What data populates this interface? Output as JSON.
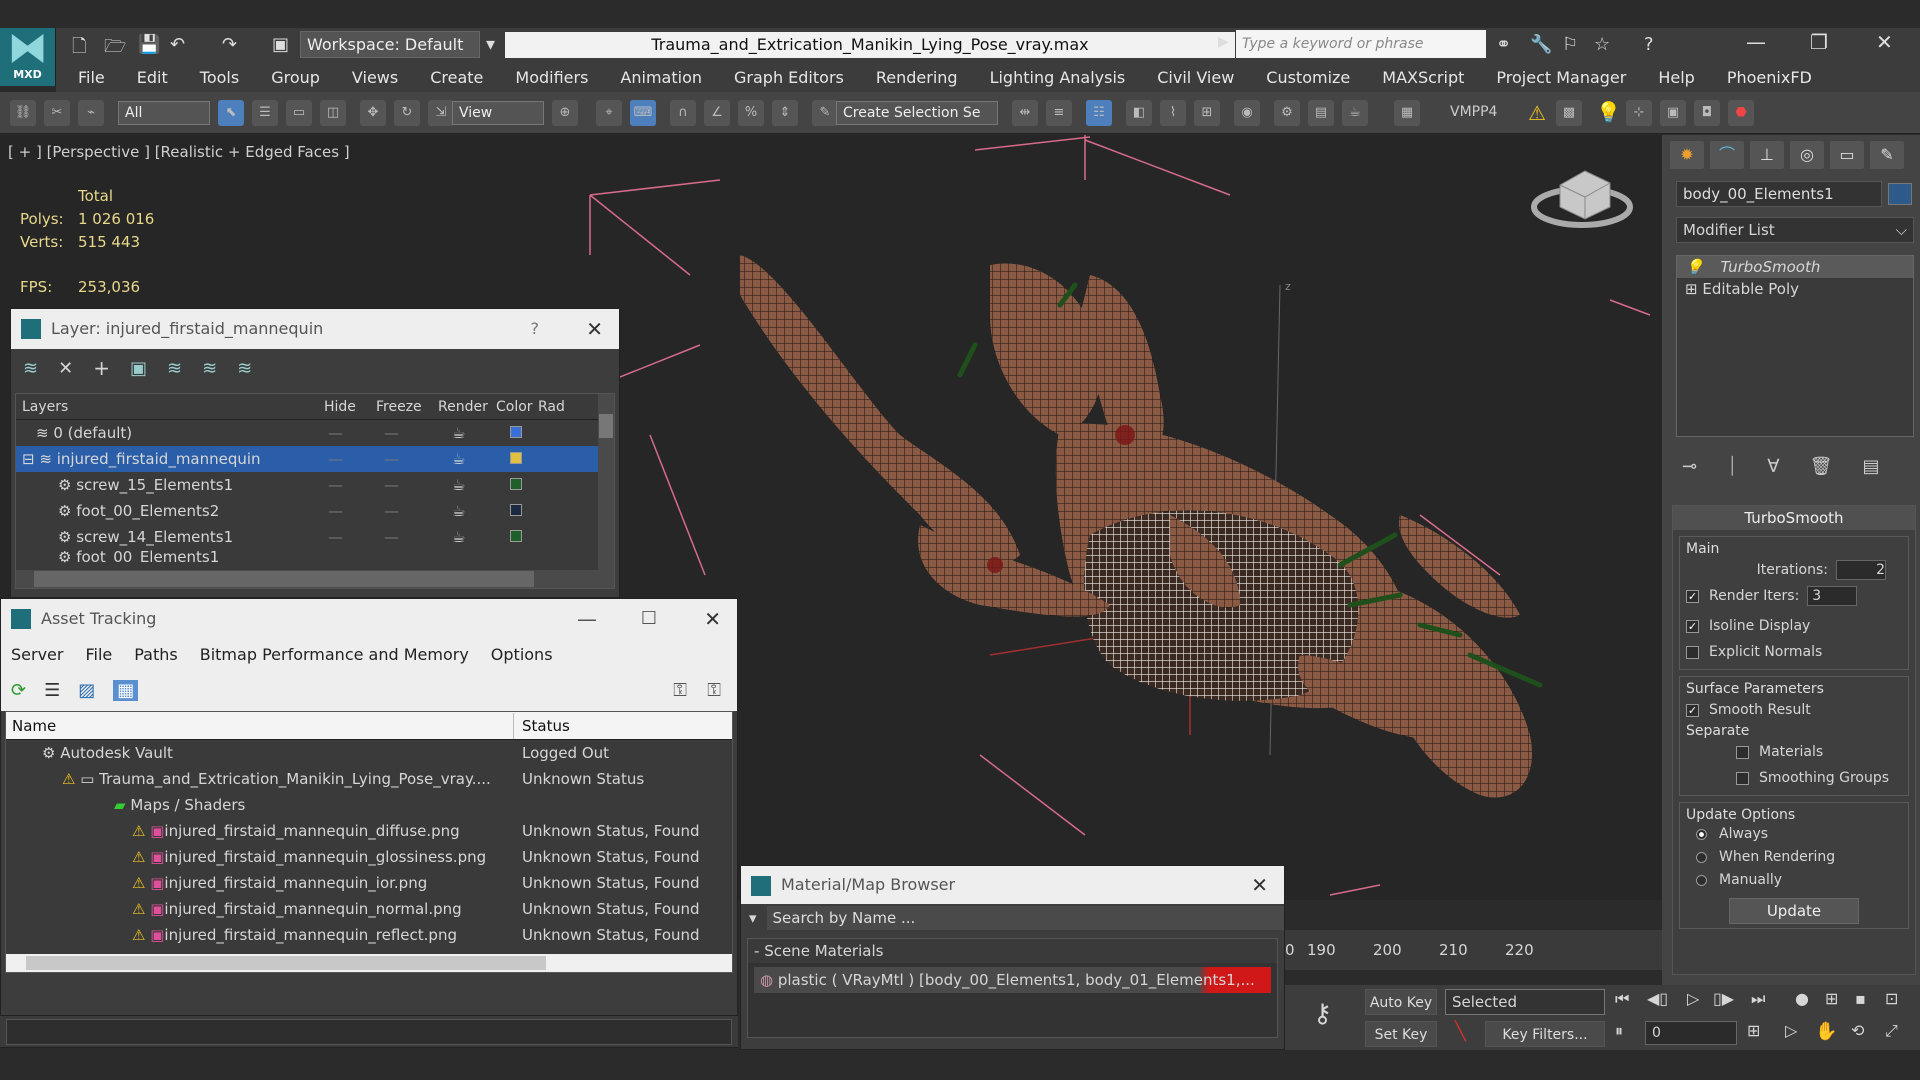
{
  "app": {
    "logo_sub": "MXD",
    "title": "Trauma_and_Extrication_Manikin_Lying_Pose_vray.max",
    "workspace": "Workspace: Default",
    "search_placeholder": "Type a keyword or phrase"
  },
  "menu": [
    "File",
    "Edit",
    "Tools",
    "Group",
    "Views",
    "Create",
    "Modifiers",
    "Animation",
    "Graph Editors",
    "Rendering",
    "Lighting Analysis",
    "Civil View",
    "Customize",
    "MAXScript",
    "Project Manager",
    "Help",
    "PhoenixFD"
  ],
  "toolbar": {
    "filter": "All",
    "refcoord": "View",
    "selset": "Create Selection Se",
    "vmpp": "VMPP4"
  },
  "viewport": {
    "label": "[ + ] [Perspective ] [Realistic + Edged Faces ]",
    "stats_header": "Total",
    "polys_label": "Polys:",
    "polys_value": "1 026 016",
    "verts_label": "Verts:",
    "verts_value": "515 443",
    "fps_label": "FPS:",
    "fps_value": "253,036"
  },
  "command_panel": {
    "object_name": "body_00_Elements1",
    "object_color": "#2e5a8a",
    "modifier_list": "Modifier List",
    "stack": [
      "TurboSmooth",
      "Editable Poly"
    ],
    "rollout_title": "TurboSmooth",
    "main_label": "Main",
    "iterations_label": "Iterations:",
    "iterations_value": "2",
    "render_iters_label": "Render Iters:",
    "render_iters_value": "3",
    "isoline_label": "Isoline Display",
    "explicit_normals_label": "Explicit Normals",
    "surface_label": "Surface Parameters",
    "smooth_result_label": "Smooth Result",
    "separate_label": "Separate",
    "materials_label": "Materials",
    "smoothing_groups_label": "Smoothing Groups",
    "update_options_label": "Update Options",
    "always_label": "Always",
    "when_rendering_label": "When Rendering",
    "manually_label": "Manually",
    "update_button": "Update"
  },
  "layer_window": {
    "title": "Layer: injured_firstaid_mannequin",
    "help": "?",
    "columns": [
      "Layers",
      "Hide",
      "Freeze",
      "Render",
      "Color",
      "Rad"
    ],
    "rows": [
      {
        "name": "0 (default)",
        "color": "#3a6fd8"
      },
      {
        "name": "injured_firstaid_mannequin",
        "color": "#e0c040"
      },
      {
        "name": "screw_15_Elements1",
        "color": "#1f5f2a"
      },
      {
        "name": "foot_00_Elements2",
        "color": "#1a2a40"
      },
      {
        "name": "screw_14_Elements1",
        "color": "#1f5f2a"
      },
      {
        "name": "foot_00_Elements1",
        "color": "#1a2a40"
      }
    ]
  },
  "asset_window": {
    "title": "Asset Tracking",
    "menu": [
      "Server",
      "File",
      "Paths",
      "Bitmap Performance and Memory",
      "Options"
    ],
    "columns": [
      "Name",
      "Status"
    ],
    "rows": [
      {
        "name": "Autodesk Vault",
        "status": "Logged Out"
      },
      {
        "name": "Trauma_and_Extrication_Manikin_Lying_Pose_vray....",
        "status": "Unknown Status"
      },
      {
        "name": "Maps / Shaders",
        "status": ""
      },
      {
        "name": "injured_firstaid_mannequin_diffuse.png",
        "status": "Unknown Status, Found"
      },
      {
        "name": "injured_firstaid_mannequin_glossiness.png",
        "status": "Unknown Status, Found"
      },
      {
        "name": "injured_firstaid_mannequin_ior.png",
        "status": "Unknown Status, Found"
      },
      {
        "name": "injured_firstaid_mannequin_normal.png",
        "status": "Unknown Status, Found"
      },
      {
        "name": "injured_firstaid_mannequin_reflect.png",
        "status": "Unknown Status, Found"
      }
    ]
  },
  "material_browser": {
    "title": "Material/Map Browser",
    "search_placeholder": "Search by Name ...",
    "section": "Scene Materials",
    "item": "plastic  ( VRayMtl ) [body_00_Elements1, body_01_Elements1,..."
  },
  "timeline": {
    "ticks": [
      "190",
      "200",
      "210",
      "220"
    ]
  },
  "bottom": {
    "auto_key": "Auto Key",
    "set_key": "Set Key",
    "key_mode": "Selected",
    "key_filters": "Key Filters...",
    "frame": "0"
  }
}
